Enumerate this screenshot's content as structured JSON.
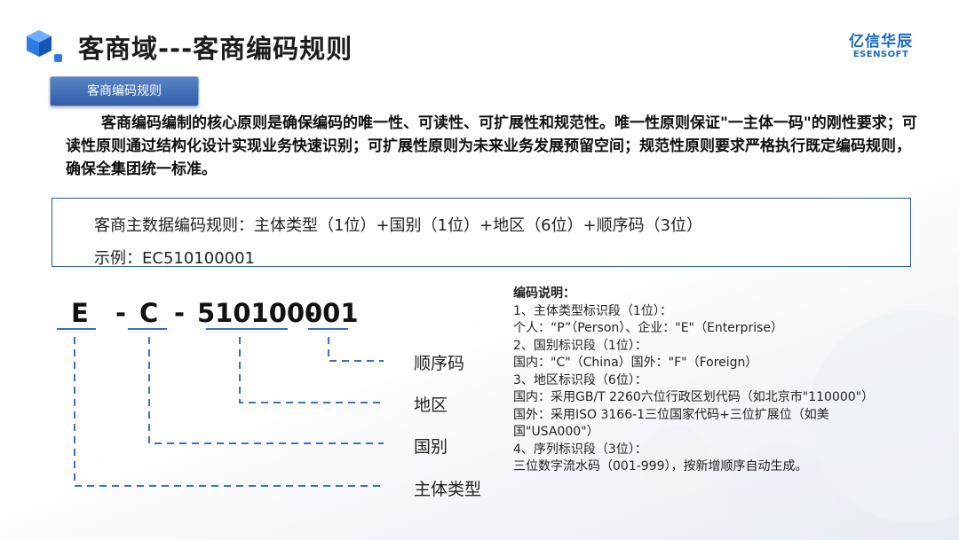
{
  "header": {
    "title": "客商域---客商编码规则",
    "logo_cn": "亿信华辰",
    "logo_en": "ESENSOFT"
  },
  "section_tag": "客商编码规则",
  "intro": "客商编码编制的核心原则是确保编码的唯一性、可读性、可扩展性和规范性。唯一性原则保证\"一主体一码\"的刚性要求；可读性原则通过结构化设计实现业务快速识别；可扩展性原则为未来业务发展预留空间；规范性原则要求严格执行既定编码规则，确保全集团统一标准。",
  "rule_box": {
    "rule": "客商主数据编码规则：主体类型（1位）+国别（1位）+地区（6位）+顺序码（3位）",
    "example": "示例：EC510100001"
  },
  "code": {
    "p1": "E",
    "d1": "-",
    "p2": "C",
    "d2": "-",
    "p3": "510100-",
    "p4": "001"
  },
  "segments": {
    "seq": "顺序码",
    "region": "地区",
    "country": "国别",
    "type": "主体类型"
  },
  "notes": {
    "heading": "编码说明：",
    "l1": "1、主体类型标识段（1位）：",
    "l2": "个人：“P”（Person）、企业：\"E\"（Enterprise）",
    "l3": "2、国别标识段（1位）：",
    "l4": "国内：\"C\"（China）国外：\"F\"（Foreign）",
    "l5": "3、地区标识段（6位）：",
    "l6": "国内：采用GB/T 2260六位行政区划代码（如北京市\"110000\"）",
    "l7": "国外：采用ISO 3166-1三位国家代码+三位扩展位（如美国\"USA000\"）",
    "l8": "4、序列标识段（3位）：",
    "l9": "三位数字流水码（001-999），按新增顺序自动生成。"
  },
  "colors": {
    "accent": "#2f5ea8",
    "line": "#3b6fc0",
    "logo": "#1769c4"
  },
  "icons": {
    "title_icon": "cube-icon"
  }
}
